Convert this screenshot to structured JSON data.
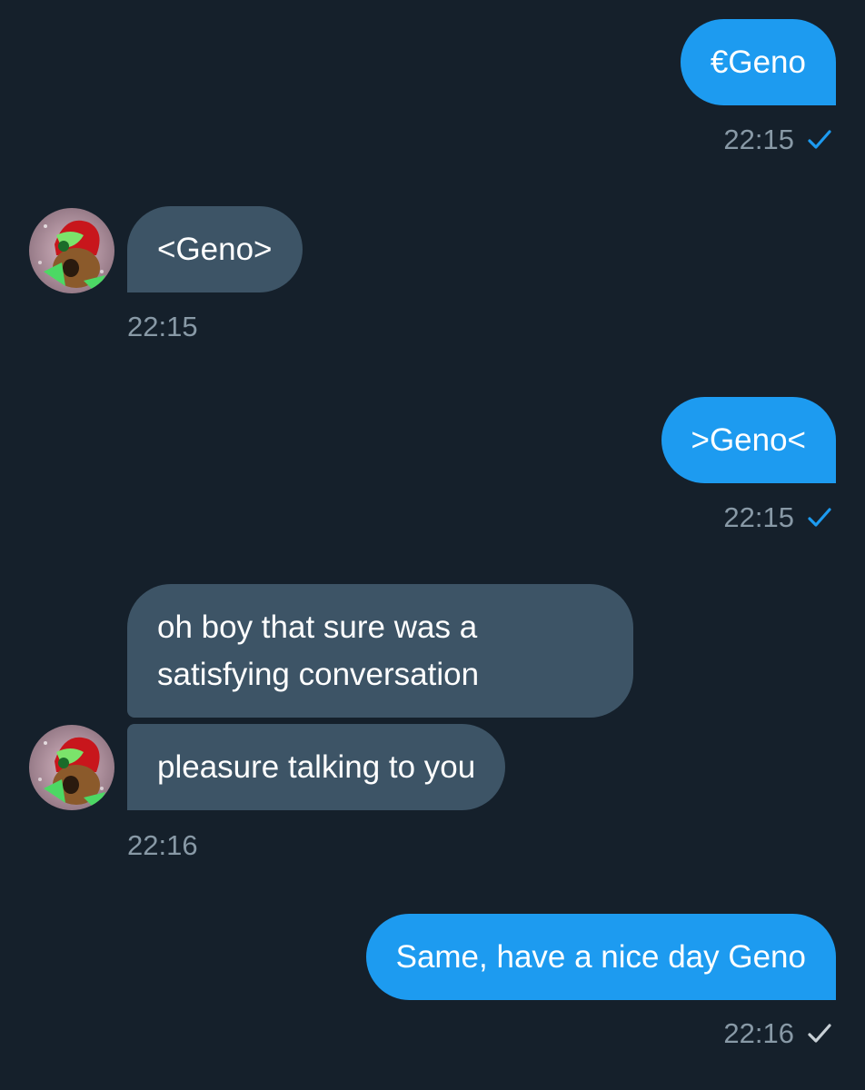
{
  "colors": {
    "background": "#15202b",
    "outgoing_bubble": "#1d9bf0",
    "incoming_bubble": "#3d5466",
    "timestamp": "#8899a6",
    "read_check": "#1d9bf0",
    "sent_check": "#c8d0d6"
  },
  "messages": [
    {
      "direction": "outgoing",
      "text": "€Geno",
      "time": "22:15",
      "status": "read-check-icon"
    },
    {
      "direction": "incoming",
      "text": "<Geno>",
      "time": "22:15",
      "avatar": "avatar-icon"
    },
    {
      "direction": "outgoing",
      "text": ">Geno<",
      "time": "22:15",
      "status": "read-check-icon"
    },
    {
      "direction": "incoming",
      "text_line1": "oh boy that sure was a",
      "text_line2": "satisfying conversation"
    },
    {
      "direction": "incoming",
      "text": "pleasure talking to you",
      "time": "22:16",
      "avatar": "avatar-icon"
    },
    {
      "direction": "outgoing",
      "text": "Same, have a nice day Geno",
      "time": "22:16",
      "status": "sent-check-icon"
    }
  ]
}
